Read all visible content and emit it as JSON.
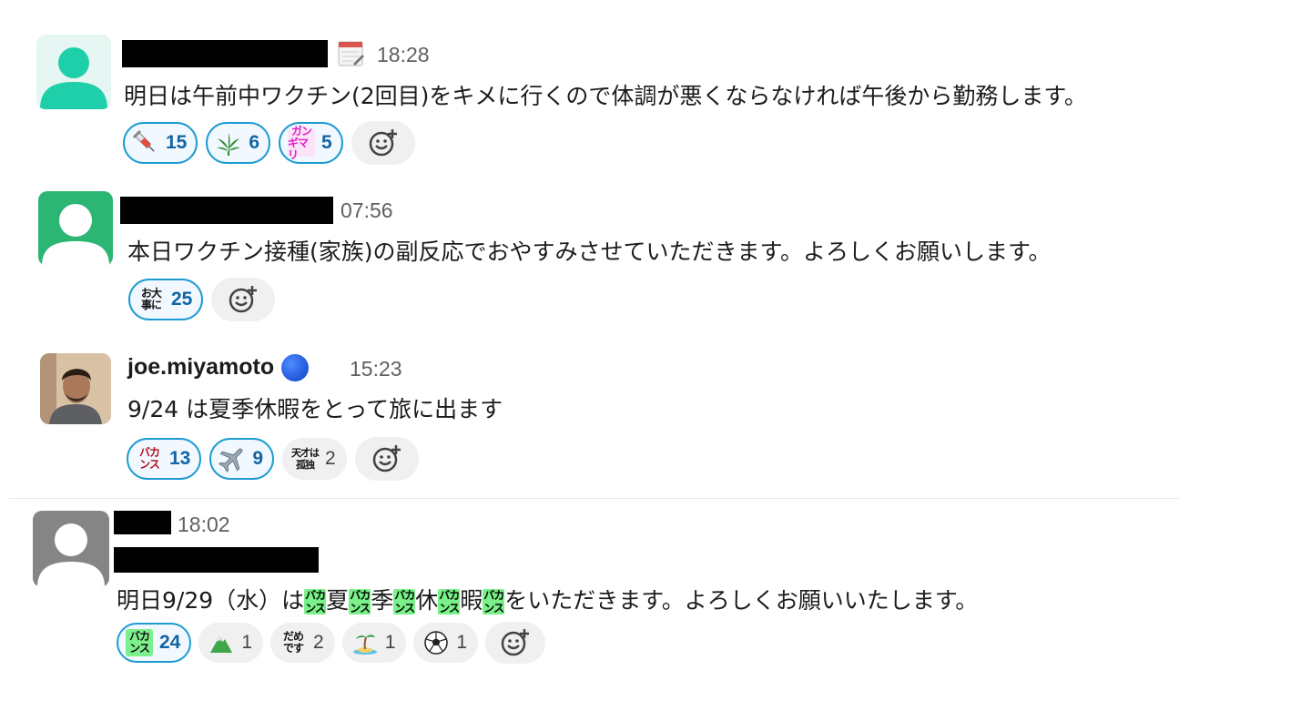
{
  "messages": [
    {
      "time": "18:28",
      "text": "明日は午前中ワクチン(2回目)をキメに行くので体調が悪くならなければ午後から勤務します。",
      "status_emoji": "calendar-icon",
      "reactions": [
        {
          "icon": "syringe-icon",
          "count": "15"
        },
        {
          "icon": "herb-icon",
          "count": "6"
        },
        {
          "icon": "gankimari-emoji",
          "label_lines": [
            "ガン",
            "ギマリ"
          ],
          "count": "5"
        }
      ]
    },
    {
      "time": "07:56",
      "text": "本日ワクチン接種(家族)の副反応でおやすみさせていただきます。よろしくお願いします。",
      "reactions": [
        {
          "icon": "odaijini-emoji",
          "label_lines": [
            "お大",
            "事に"
          ],
          "count": "25"
        }
      ]
    },
    {
      "author": "joe.miyamoto",
      "status_emoji": "blue-circle-icon",
      "time": "15:23",
      "text": "9/24 は夏季休暇をとって旅に出ます",
      "reactions": [
        {
          "icon": "bakansu-emoji",
          "label_lines": [
            "バカ",
            "ンス"
          ],
          "count": "13"
        },
        {
          "icon": "airplane-icon",
          "count": "9"
        },
        {
          "icon": "tensai-wa-kodoku-emoji",
          "label_lines": [
            "天才は",
            "孤独"
          ],
          "count": "2"
        }
      ]
    },
    {
      "time": "18:02",
      "text_parts": [
        "明日9/29（水）は",
        "夏",
        "季",
        "休",
        "暇",
        "をいただきます。よろしくお願いいたします。"
      ],
      "inline_emoji_lines": [
        "バカ",
        "ンス"
      ],
      "reactions": [
        {
          "icon": "bakansu-emoji",
          "label_lines": [
            "バカ",
            "ンス"
          ],
          "count": "24"
        },
        {
          "icon": "mountain-icon",
          "count": "1"
        },
        {
          "icon": "damedesu-emoji",
          "label_lines": [
            "だめ",
            "です"
          ],
          "count": "2"
        },
        {
          "icon": "desert-island-icon",
          "count": "1"
        },
        {
          "icon": "soccer-ball-icon",
          "count": "1"
        }
      ]
    }
  ],
  "colors": {
    "highlight_border": "#1d9bd1",
    "highlight_text": "#1264a3",
    "avatar1": "#3dd6b8",
    "avatar2": "#2bb673",
    "avatar4": "#8a8a8a"
  }
}
